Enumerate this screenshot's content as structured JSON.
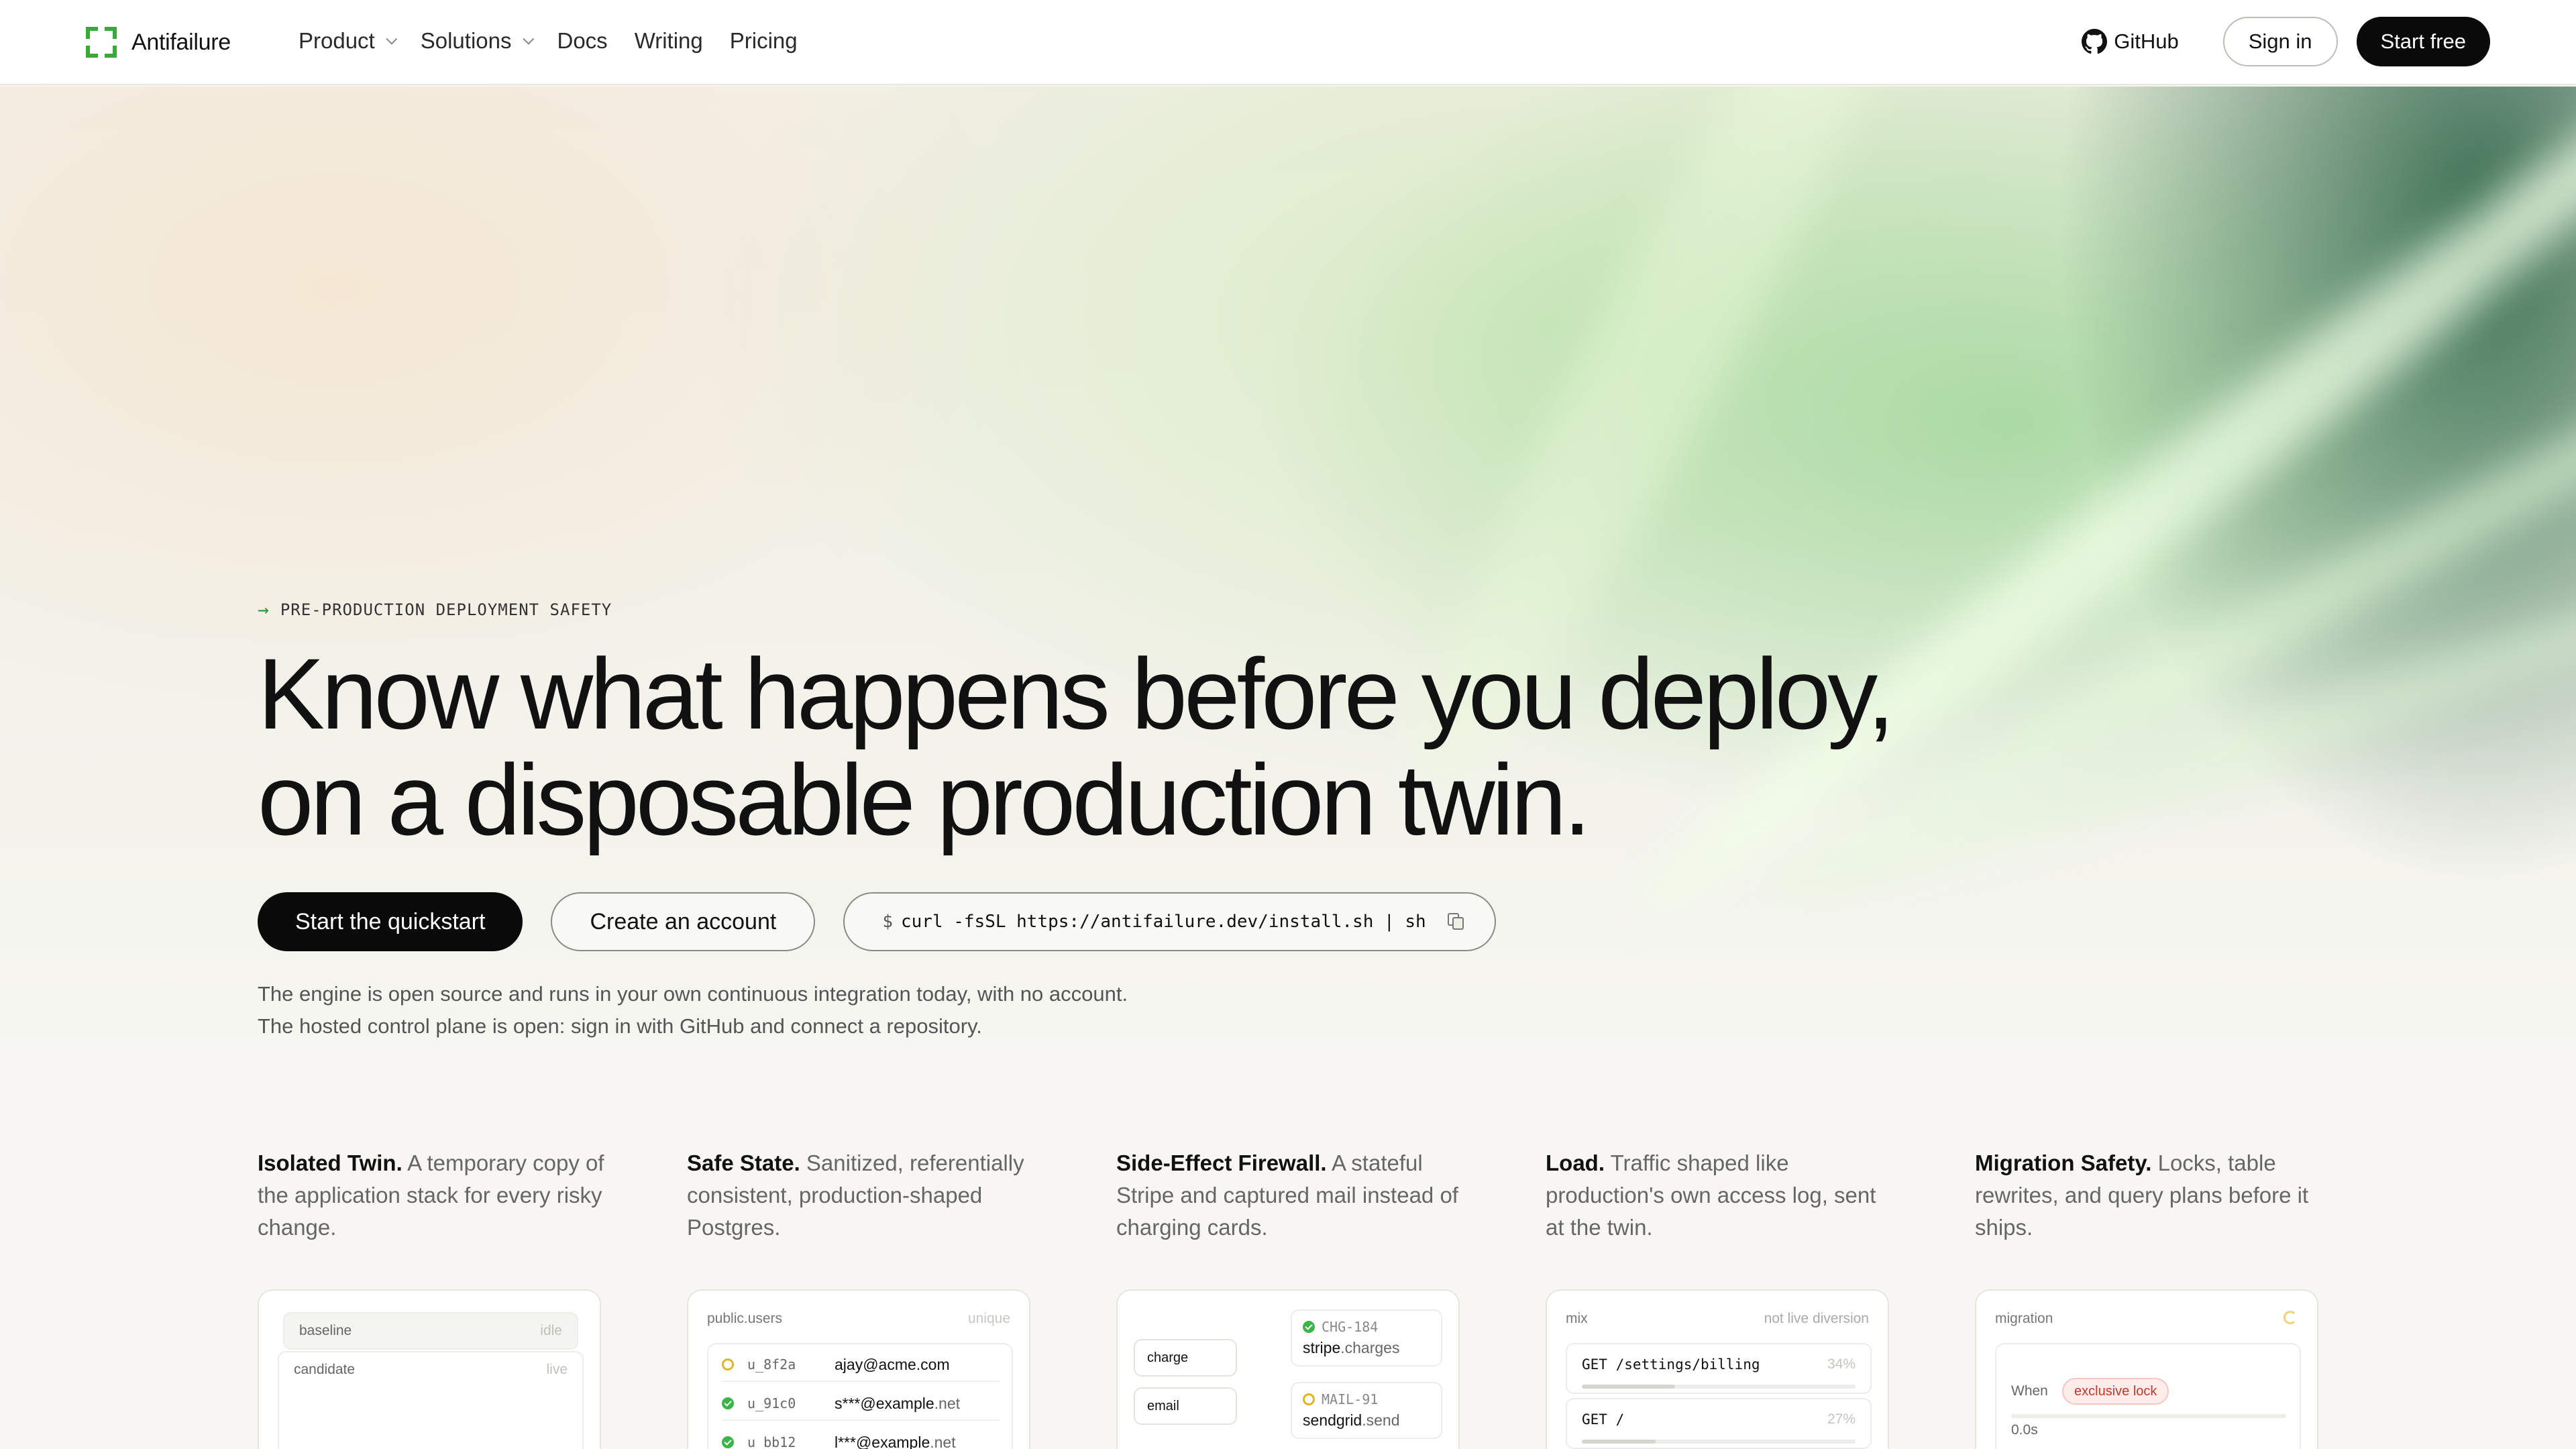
{
  "brand": {
    "name": "Antifailure",
    "accent": "#3aa83a"
  },
  "nav": {
    "menu": [
      {
        "label": "Product",
        "dropdown": true
      },
      {
        "label": "Solutions",
        "dropdown": true
      },
      {
        "label": "Docs",
        "dropdown": false
      },
      {
        "label": "Writing",
        "dropdown": false
      },
      {
        "label": "Pricing",
        "dropdown": false
      }
    ],
    "github": "GitHub",
    "sign_in": "Sign in",
    "start_free": "Start free"
  },
  "hero": {
    "eyebrow": "PRE-PRODUCTION DEPLOYMENT SAFETY",
    "headline_line1": "Know what happens before you deploy,",
    "headline_line2": "on a disposable production twin.",
    "cta_primary": "Start the quickstart",
    "cta_secondary": "Create an account",
    "install_prompt": "$",
    "install_command": "curl -fsSL https://antifailure.dev/install.sh | sh",
    "sub_line1": "The engine is open source and runs in your own continuous integration today, with no account.",
    "sub_line2": "The hosted control plane is open: sign in with GitHub and connect a repository."
  },
  "features": [
    {
      "title": "Isolated Twin.",
      "desc": "A temporary copy of the application stack for every risky change."
    },
    {
      "title": "Safe State.",
      "desc": "Sanitized, referentially consistent, production-shaped Postgres."
    },
    {
      "title": "Side-Effect Firewall.",
      "desc": "A stateful Stripe and captured mail instead of charging cards."
    },
    {
      "title": "Load.",
      "desc": "Traffic shaped like production's own access log, sent at the twin."
    },
    {
      "title": "Migration Safety.",
      "desc": "Locks, table rewrites, and query plans before it ships."
    }
  ],
  "cards": {
    "twin": {
      "rows": [
        {
          "label": "baseline",
          "state": "idle"
        },
        {
          "label": "candidate",
          "state": "live"
        }
      ]
    },
    "state": {
      "table": "public.users",
      "constraint": "unique",
      "rows": [
        {
          "status": "pending",
          "id": "u_8f2a",
          "email": "ajay@acme.com"
        },
        {
          "status": "ok",
          "id": "u_91c0",
          "email_user": "s***@example",
          "email_tld": ".net"
        },
        {
          "status": "ok",
          "id": "u_bb12",
          "email_user": "l***@example",
          "email_tld": ".net"
        }
      ]
    },
    "firewall": {
      "inputs": [
        "charge",
        "email"
      ],
      "outputs": [
        {
          "status": "ok",
          "ref": "CHG-184",
          "service": "stripe",
          "call": ".charges"
        },
        {
          "status": "pending",
          "ref": "MAIL-91",
          "service": "sendgrid",
          "call": ".send"
        }
      ]
    },
    "load": {
      "label": "mix",
      "note": "not live diversion",
      "routes": [
        {
          "path": "GET /settings/billing",
          "share": 34,
          "share_label": "34%"
        },
        {
          "path": "GET /",
          "share": 27,
          "share_label": "27%"
        }
      ]
    },
    "migration": {
      "label": "migration",
      "when": "When",
      "lock": "exclusive lock",
      "time": "0.0s"
    }
  }
}
